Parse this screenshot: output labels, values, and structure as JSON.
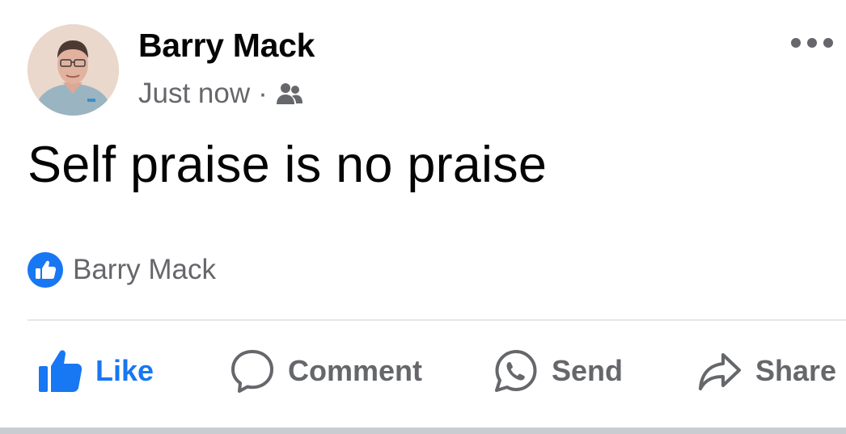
{
  "post": {
    "author": "Barry Mack",
    "timestamp": "Just now",
    "separator": "·",
    "audience_icon": "friends-icon",
    "text": "Self praise is no praise"
  },
  "reactions": {
    "badge_icon": "like-reaction-icon",
    "names": "Barry Mack"
  },
  "actions": {
    "like": {
      "label": "Like",
      "icon": "thumbs-up-icon"
    },
    "comment": {
      "label": "Comment",
      "icon": "comment-bubble-icon"
    },
    "send": {
      "label": "Send",
      "icon": "whatsapp-icon"
    },
    "share": {
      "label": "Share",
      "icon": "share-arrow-icon"
    }
  },
  "colors": {
    "accent": "#1877f2",
    "secondary_text": "#65676b",
    "primary_text": "#050505",
    "divider": "#e4e6eb"
  }
}
